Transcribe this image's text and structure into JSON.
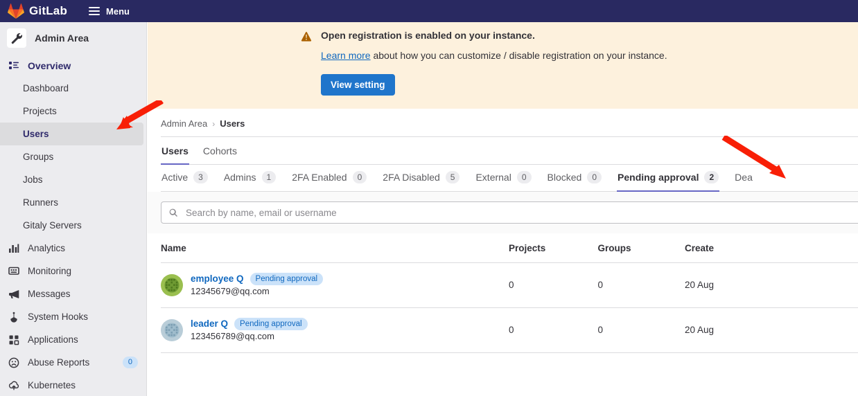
{
  "topnav": {
    "brand": "GitLab",
    "menu_label": "Menu",
    "brand_bg": "#292961"
  },
  "sidebar": {
    "context_title": "Admin Area",
    "context_icon": "wrench-icon",
    "group": {
      "label": "Overview",
      "icon": "overview-icon"
    },
    "sub_items": [
      {
        "label": "Dashboard",
        "active": false
      },
      {
        "label": "Projects",
        "active": false
      },
      {
        "label": "Users",
        "active": true
      },
      {
        "label": "Groups",
        "active": false
      },
      {
        "label": "Jobs",
        "active": false
      },
      {
        "label": "Runners",
        "active": false
      },
      {
        "label": "Gitaly Servers",
        "active": false
      }
    ],
    "main_items": [
      {
        "label": "Analytics",
        "icon": "chart-icon",
        "badge": null
      },
      {
        "label": "Monitoring",
        "icon": "monitor-icon",
        "badge": null
      },
      {
        "label": "Messages",
        "icon": "megaphone-icon",
        "badge": null
      },
      {
        "label": "System Hooks",
        "icon": "hook-icon",
        "badge": null
      },
      {
        "label": "Applications",
        "icon": "applications-icon",
        "badge": null
      },
      {
        "label": "Abuse Reports",
        "icon": "abuse-icon",
        "badge": "0"
      },
      {
        "label": "Kubernetes",
        "icon": "kubernetes-icon",
        "badge": null
      }
    ]
  },
  "alert": {
    "icon": "warning-icon",
    "title": "Open registration is enabled on your instance.",
    "link_text": "Learn more",
    "body_rest": " about how you can customize / disable registration on your instance.",
    "button_label": "View setting",
    "bg": "#fdf1dd",
    "button_bg": "#1f75cb"
  },
  "breadcrumb": {
    "parent": "Admin Area",
    "separator": "›",
    "current": "Users"
  },
  "subtabs": [
    {
      "label": "Users",
      "active": true
    },
    {
      "label": "Cohorts",
      "active": false
    }
  ],
  "filters": [
    {
      "label": "Active",
      "count": "3",
      "active": false
    },
    {
      "label": "Admins",
      "count": "1",
      "active": false
    },
    {
      "label": "2FA Enabled",
      "count": "0",
      "active": false
    },
    {
      "label": "2FA Disabled",
      "count": "5",
      "active": false
    },
    {
      "label": "External",
      "count": "0",
      "active": false
    },
    {
      "label": "Blocked",
      "count": "0",
      "active": false
    },
    {
      "label": "Pending approval",
      "count": "2",
      "active": true
    },
    {
      "label": "Dea",
      "count": "",
      "active": false
    }
  ],
  "search": {
    "placeholder": "Search by name, email or username",
    "value": "",
    "icon": "search-icon"
  },
  "table": {
    "columns": [
      "Name",
      "Projects",
      "Groups",
      "Create"
    ],
    "rows": [
      {
        "name": "employee Q",
        "badge": "Pending approval",
        "email": "12345679@qq.com",
        "projects": "0",
        "groups": "0",
        "created": "20 Aug",
        "avatar": "identicon-green"
      },
      {
        "name": "leader Q",
        "badge": "Pending approval",
        "email": "123456789@qq.com",
        "projects": "0",
        "groups": "0",
        "created": "20 Aug",
        "avatar": "identicon-blue"
      }
    ]
  },
  "annotations": {
    "arrow_color": "#f81f06",
    "arrows": [
      {
        "name": "arrow-to-users-sidebar"
      },
      {
        "name": "arrow-to-pending-approval-tab"
      }
    ]
  }
}
